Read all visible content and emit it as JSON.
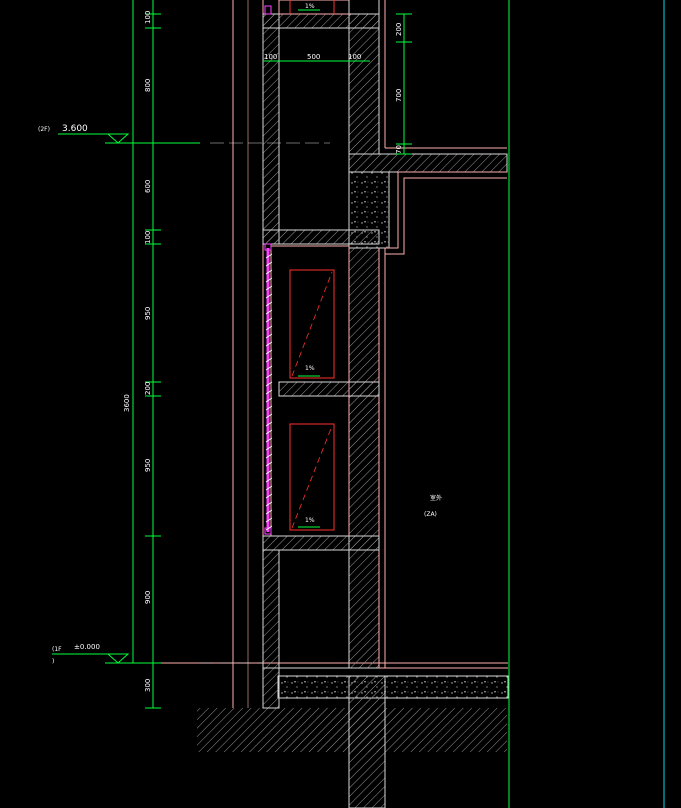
{
  "drawing": {
    "colors": {
      "background": "#000000",
      "dimension_line": "#00ff3c",
      "wall_outline": "#ffb0b0",
      "concrete": "#d8d8d8",
      "hatch": "#9a9a9a",
      "axis": "#00ff3c",
      "window_frame": "#ff3030",
      "glass_rail": "#ff40ff",
      "cyan_line": "#00e0e0",
      "text": "#ffffff"
    },
    "levels": {
      "upper_tag": "(2F)",
      "upper_value": "3.600",
      "ground_tag": "(1F",
      "ground_sub": ")",
      "ground_value": "±0.000"
    },
    "left_dimensions": [
      {
        "id": "d100a",
        "text": "100"
      },
      {
        "id": "d800",
        "text": "800"
      },
      {
        "id": "d600",
        "text": "600"
      },
      {
        "id": "d100b",
        "text": "100"
      },
      {
        "id": "d950a",
        "text": "950"
      },
      {
        "id": "d200",
        "text": "200"
      },
      {
        "id": "d950b",
        "text": "950"
      },
      {
        "id": "d900",
        "text": "900"
      },
      {
        "id": "d300",
        "text": "300"
      }
    ],
    "total_dimension": "3600",
    "top_dimensions": {
      "left": "100",
      "middle": "500",
      "right": "100"
    },
    "right_dimensions": [
      {
        "id": "r200",
        "text": "200"
      },
      {
        "id": "r700",
        "text": "700"
      },
      {
        "id": "r70",
        "text": "70"
      }
    ],
    "room_label": {
      "line1": "室外",
      "line2": "(ZA)"
    },
    "slope_labels": [
      "1%",
      "1%",
      "1%"
    ]
  }
}
